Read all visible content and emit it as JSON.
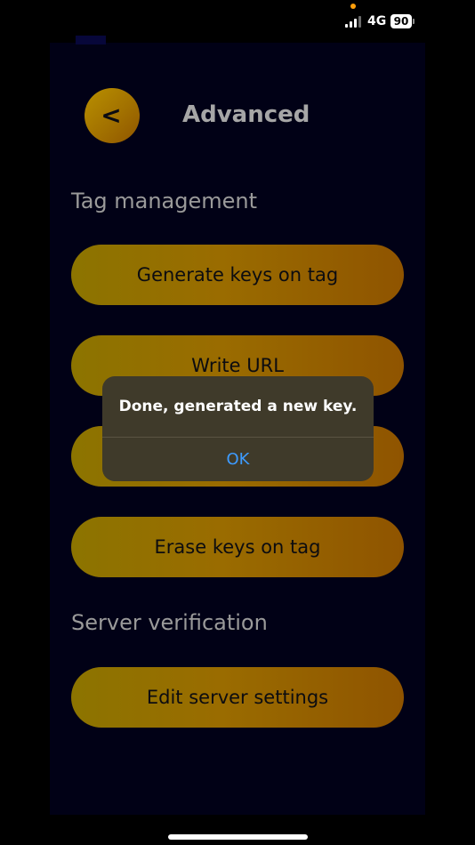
{
  "status_bar": {
    "network": "4G",
    "battery": "90",
    "icons": [
      "signal-icon",
      "battery-icon"
    ]
  },
  "header": {
    "back_glyph": "<",
    "title": "Advanced"
  },
  "sections": {
    "tag_management": "Tag management",
    "server_verification": "Server verification"
  },
  "buttons": {
    "generate_keys": "Generate keys on tag",
    "write_url": "Write URL",
    "erase_keys": "Erase keys on tag",
    "edit_server_settings": "Edit server settings"
  },
  "alert": {
    "message": "Done, generated a new key.",
    "ok_label": "OK"
  },
  "colors": {
    "accent": "#a27100",
    "alert_background": "#3f3a2a",
    "link_blue": "#3d9bff"
  }
}
